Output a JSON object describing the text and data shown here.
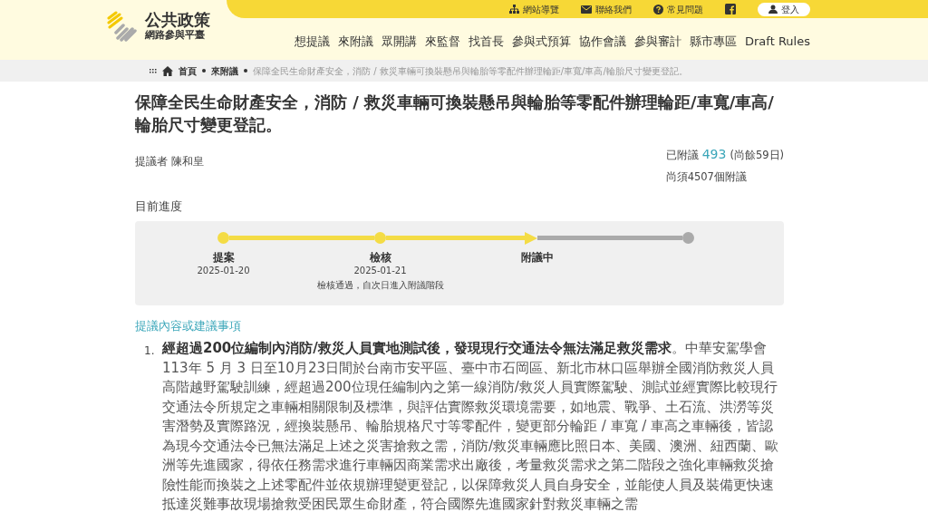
{
  "site": {
    "name": "公共政策",
    "subtitle": "網路參與平臺"
  },
  "top_links": [
    {
      "kind": "sitemap",
      "label": "網站導覽"
    },
    {
      "kind": "mail",
      "label": "聯絡我們"
    },
    {
      "kind": "help",
      "label": "常見問題"
    },
    {
      "kind": "facebook"
    },
    {
      "kind": "login",
      "label": "登入"
    }
  ],
  "nav": [
    {
      "label": "想提議",
      "selected": false
    },
    {
      "label": "來附議",
      "selected": false
    },
    {
      "label": "眾開講",
      "selected": false
    },
    {
      "label": "來監督",
      "selected": false
    },
    {
      "label": "找首長",
      "selected": false
    },
    {
      "label": "參與式預算",
      "selected": false
    },
    {
      "label": "協作會議",
      "selected": false
    },
    {
      "label": "參與審計",
      "selected": false
    },
    {
      "label": "縣市專區",
      "selected": false
    },
    {
      "label": "Draft Rules",
      "selected": false
    }
  ],
  "breadcrumb": [
    {
      "label": "首頁",
      "kind": "link"
    },
    {
      "label": "來附議",
      "kind": "link"
    },
    {
      "label": "保障全民生命財產安全，消防 / 救災車輛可換裝懸吊與輪胎等零配件辦理輪距/車寬/車高/輪胎尺寸變更登記。",
      "kind": "current"
    }
  ],
  "title": "保障全民生命財產安全，消防 / 救災車輛可換裝懸吊與輪胎等零配件辦理輪距/車寬/車高/輪胎尺寸變更登記。",
  "proposer": {
    "label": "提議者",
    "name": "陳和皇"
  },
  "stats": {
    "signed_label": "已附議",
    "signed": "493",
    "remaining": "(尚餘59日)",
    "needed": "尚須4507個附議"
  },
  "progress": {
    "heading": "目前進度",
    "steps": [
      {
        "label": "提案",
        "date": "2025-01-20",
        "kind": "done"
      },
      {
        "label": "檢核",
        "date": "2025-01-21",
        "note": "檢核通過，自次日進入附議階段",
        "kind": "done"
      },
      {
        "label": "附議中",
        "kind": "current"
      },
      {
        "kind": "pending"
      }
    ]
  },
  "content": {
    "heading": "提議內容或建議事項",
    "items": [
      {
        "marker": "1.",
        "text": "**經超過200位編制內消防/救災人員實地測試後，發現現行交通法令無法滿足救災需求**。中華安駕學會113年 5 月 3 日至10月23日間於台南市安平區、臺中市石岡區、新北市林口區舉辦全國消防救災人員高階越野駕駛訓練，經超過200位現任編制內之第一線消防/救災人員實際駕駛、測試並經實際比較現行交通法令所規定之車輛相關限制及標準，與評估實際救災環境需要，如地震、戰爭、土石流、洪澇等災害潛勢及實際路況，經換裝懸吊、輪胎規格尺寸等零配件，變更部分輪距 / 車寬 /  車高之車輛後，皆認為現今交通法令已無法滿足上述之災害搶救之需，消防/救災車輛應比照日本、美國、澳洲、紐西蘭、歐洲等先進國家，得依任務需求進行車輛因商業需求出廠後，考量救災需求之第二階段之強化車輛救災搶險性能而換裝之上述零配件並依規辦理變更登記，以保障救災人員自身安全，並能使人員及裝備更快速抵達災難事故現場搶救受困民眾生命財產，符合國際先進國家針對救災車輛之需"
      }
    ]
  }
}
